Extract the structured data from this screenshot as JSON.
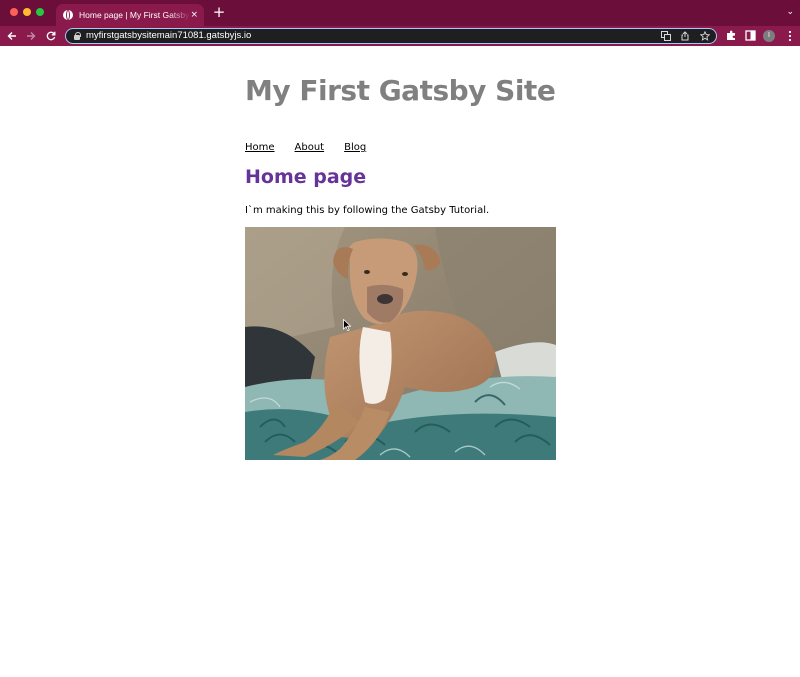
{
  "browser": {
    "tab_title": "Home page | My First Gatsby Site",
    "tab_close": "×",
    "new_tab": "+",
    "tab_menu": "⌄",
    "url": "myfirstgatsbysitemain71081.gatsbyjs.io",
    "profile_initial": "I",
    "icons": {
      "back": "arrow-left-icon",
      "forward": "arrow-right-icon",
      "reload": "reload-icon",
      "lock": "lock-icon",
      "translate": "translate-icon",
      "share": "share-icon",
      "bookmark": "star-icon",
      "extensions": "puzzle-icon",
      "side_panel": "side-panel-icon",
      "menu": "kebab-menu-icon"
    },
    "colors": {
      "tabbar": "#6b0f3a",
      "toolbar": "#8a1a4c",
      "omnibox": "#1f1f22",
      "focus_ring": "#a8c7fa"
    }
  },
  "page": {
    "site_title": "My First Gatsby Site",
    "nav": [
      {
        "label": "Home"
      },
      {
        "label": "About"
      },
      {
        "label": "Blog"
      }
    ],
    "heading": "Home page",
    "paragraph": "I`m making this by following the Gatsby Tutorial.",
    "colors": {
      "site_title": "#808080",
      "heading": "#663399",
      "text": "#000000"
    }
  }
}
